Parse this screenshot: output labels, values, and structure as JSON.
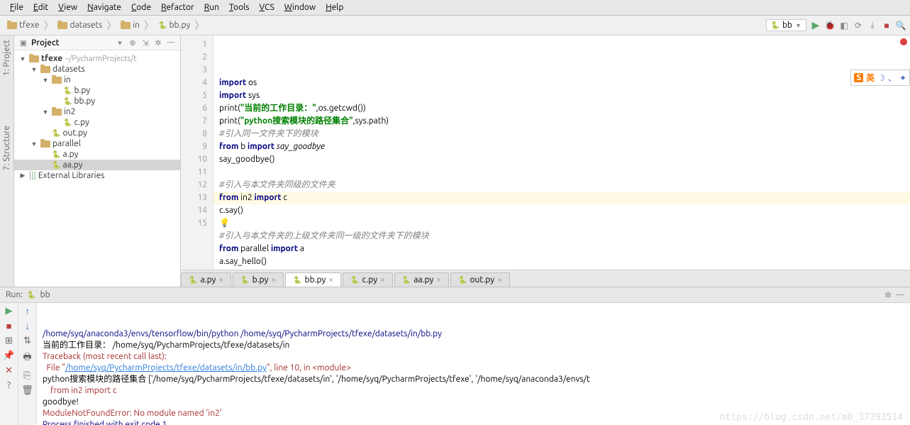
{
  "menu": [
    "File",
    "Edit",
    "View",
    "Navigate",
    "Code",
    "Refactor",
    "Run",
    "Tools",
    "VCS",
    "Window",
    "Help"
  ],
  "breadcrumb": [
    {
      "icon": "folder",
      "label": "tfexe"
    },
    {
      "icon": "folder",
      "label": "datasets"
    },
    {
      "icon": "folder",
      "label": "in"
    },
    {
      "icon": "py",
      "label": "bb.py"
    }
  ],
  "run_config": "bb",
  "panel_title": "Project",
  "tree": [
    {
      "indent": 0,
      "arrow": "▼",
      "icon": "folder",
      "name": "tfexe",
      "path": "~/PycharmProjects/t",
      "bold": true
    },
    {
      "indent": 1,
      "arrow": "▼",
      "icon": "folder",
      "name": "datasets"
    },
    {
      "indent": 2,
      "arrow": "▼",
      "icon": "folder",
      "name": "in"
    },
    {
      "indent": 3,
      "arrow": "",
      "icon": "py",
      "name": "b.py"
    },
    {
      "indent": 3,
      "arrow": "",
      "icon": "py",
      "name": "bb.py"
    },
    {
      "indent": 2,
      "arrow": "▼",
      "icon": "folder",
      "name": "in2"
    },
    {
      "indent": 3,
      "arrow": "",
      "icon": "py",
      "name": "c.py"
    },
    {
      "indent": 2,
      "arrow": "",
      "icon": "py",
      "name": "out.py"
    },
    {
      "indent": 1,
      "arrow": "▼",
      "icon": "folder",
      "name": "parallel"
    },
    {
      "indent": 2,
      "arrow": "",
      "icon": "py",
      "name": "a.py"
    },
    {
      "indent": 2,
      "arrow": "",
      "icon": "py",
      "name": "aa.py",
      "selected": true
    },
    {
      "indent": 0,
      "arrow": "▶",
      "icon": "lib",
      "name": "External Libraries"
    }
  ],
  "code_lines": [
    {
      "n": 1,
      "html": "<span class='kw'>import</span> os"
    },
    {
      "n": 2,
      "html": "<span class='kw'>import</span> sys"
    },
    {
      "n": 3,
      "html": "print(<span class='str'>\"当前的工作目录：\"</span>,os.getcwd())"
    },
    {
      "n": 4,
      "html": "print(<span class='str'>\"python搜索模块的路径集合\"</span>,sys.path)"
    },
    {
      "n": 5,
      "html": "<span class='cm'>#引入同一文件夹下的模块</span>"
    },
    {
      "n": 6,
      "html": "<span class='kw'>from</span> b <span class='kw'>import</span> <span class='fn'>say_goodbye</span>"
    },
    {
      "n": 7,
      "html": "say_goodbye()"
    },
    {
      "n": 8,
      "html": ""
    },
    {
      "n": 9,
      "html": "<span class='cm'>#引入与本文件夹同级的文件夹</span>"
    },
    {
      "n": 10,
      "html": "<span class='kw'>from</span> in2 <span class='kw'>import</span> c"
    },
    {
      "n": 11,
      "html": "c.say()"
    },
    {
      "n": 12,
      "html": "<span class='bulb'>💡</span>"
    },
    {
      "n": 13,
      "html": "<span class='cm'>#引入与本文件夹的上级文件夹同一级的文件夹下的模块</span>"
    },
    {
      "n": 14,
      "html": "<span class='kw'>from</span> parallel <span class='kw'>import</span> a"
    },
    {
      "n": 15,
      "html": "a.say_hello()"
    }
  ],
  "tabs": [
    {
      "label": "a.py"
    },
    {
      "label": "b.py"
    },
    {
      "label": "bb.py",
      "active": true
    },
    {
      "label": "c.py"
    },
    {
      "label": "aa.py"
    },
    {
      "label": "out.py"
    }
  ],
  "run_label": "Run:",
  "run_target": "bb",
  "console": [
    {
      "cls": "c-blue",
      "text": "/home/syq/anaconda3/envs/tensorflow/bin/python /home/syq/PycharmProjects/tfexe/datasets/in/bb.py"
    },
    {
      "cls": "",
      "text": "当前的工作目录： /home/syq/PycharmProjects/tfexe/datasets/in"
    },
    {
      "cls": "c-red",
      "text": "Traceback (most recent call last):"
    },
    {
      "cls": "",
      "html": "  File \"<span class='c-link'>/home/syq/PycharmProjects/tfexe/datasets/in/bb.py</span>\", line 10, in &lt;module&gt;",
      "red": true
    },
    {
      "cls": "",
      "text": "python搜索模块的路径集合 ['/home/syq/PycharmProjects/tfexe/datasets/in', '/home/syq/PycharmProjects/tfexe', '/home/syq/anaconda3/envs/t"
    },
    {
      "cls": "c-red",
      "text": "    from in2 import c"
    },
    {
      "cls": "",
      "text": "goodbye!"
    },
    {
      "cls": "c-red",
      "text": "ModuleNotFoundError: No module named 'in2'"
    },
    {
      "cls": "",
      "text": ""
    },
    {
      "cls": "c-blue",
      "text": "Process finished with exit code 1"
    }
  ],
  "watermark": "https://blog.csdn.net/m0_37393514",
  "ime": {
    "eng": "英"
  }
}
